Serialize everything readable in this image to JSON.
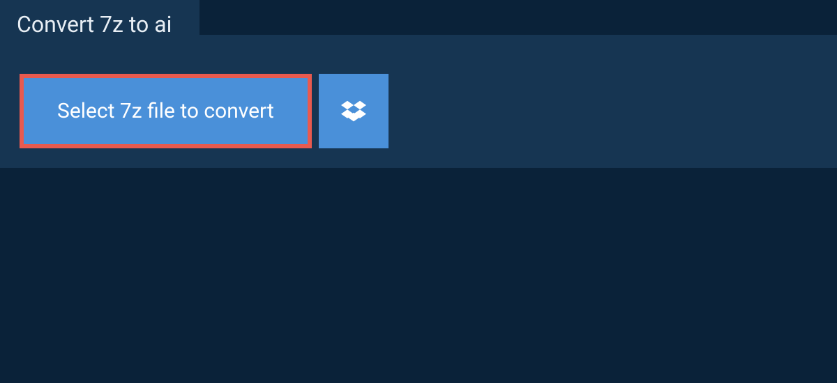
{
  "tab": {
    "title": "Convert 7z to ai"
  },
  "actions": {
    "select_label": "Select 7z file to convert"
  },
  "icons": {
    "dropbox": "dropbox-icon"
  },
  "colors": {
    "background": "#0a2239",
    "panel": "#163552",
    "button": "#4a90d9",
    "highlight_border": "#e85a4f"
  }
}
